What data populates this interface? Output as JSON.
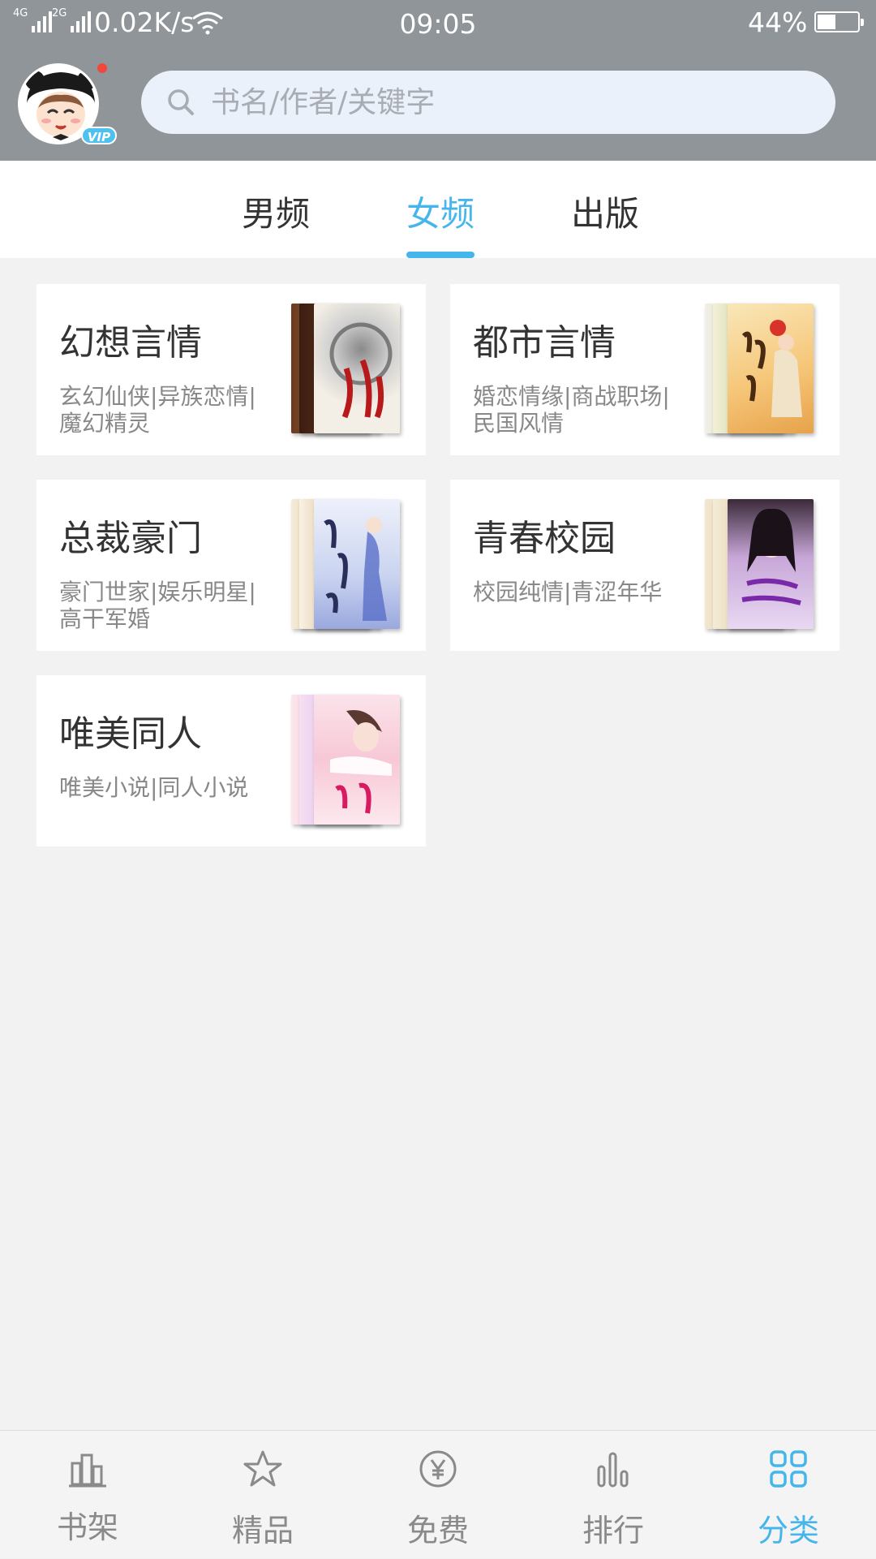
{
  "status_bar": {
    "network_1": "4G",
    "network_2": "2G",
    "speed": "0.02K/s",
    "time": "09:05",
    "battery_percent": "44%",
    "battery_level": 0.44
  },
  "header": {
    "avatar_badge": "VIP",
    "avatar_icon": "panda-avatar-icon",
    "search": {
      "placeholder": "书名/作者/关键字",
      "value": ""
    }
  },
  "tabs": [
    {
      "label": "男频",
      "active": false
    },
    {
      "label": "女频",
      "active": true
    },
    {
      "label": "出版",
      "active": false
    }
  ],
  "categories": [
    {
      "title": "幻想言情",
      "desc": "玄幻仙侠|异族恋情|魔幻精灵"
    },
    {
      "title": "都市言情",
      "desc": "婚恋情缘|商战职场|民国风情"
    },
    {
      "title": "总裁豪门",
      "desc": "豪门世家|娱乐明星|高干军婚"
    },
    {
      "title": "青春校园",
      "desc": "校园纯情|青涩年华"
    },
    {
      "title": "唯美同人",
      "desc": "唯美小说|同人小说"
    }
  ],
  "bottom_nav": [
    {
      "label": "书架",
      "icon": "bookshelf-icon",
      "active": false
    },
    {
      "label": "精品",
      "icon": "star-icon",
      "active": false
    },
    {
      "label": "免费",
      "icon": "yuan-coin-icon",
      "active": false
    },
    {
      "label": "排行",
      "icon": "bar-chart-icon",
      "active": false
    },
    {
      "label": "分类",
      "icon": "grid-icon",
      "active": true
    }
  ],
  "colors": {
    "accent": "#45b6ec",
    "header_bg": "#8f9599",
    "page_bg": "#f2f2f2",
    "notification_dot": "#f2483c"
  }
}
